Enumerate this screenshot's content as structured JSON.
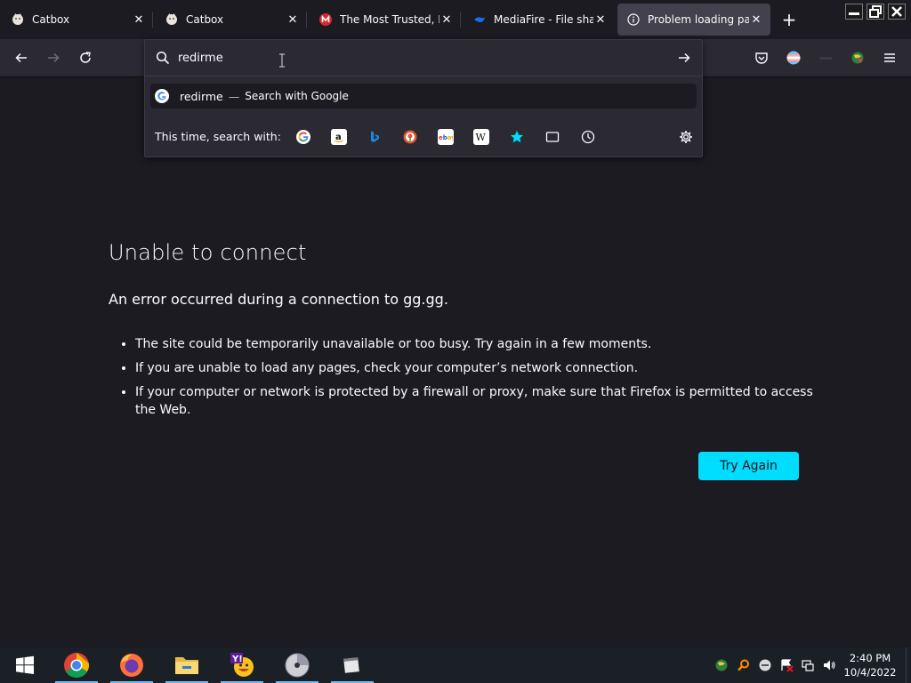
{
  "tabs": [
    {
      "title": "Catbox",
      "favicon": "catbox-icon"
    },
    {
      "title": "Catbox",
      "favicon": "catbox-icon"
    },
    {
      "title": "The Most Trusted, Bes",
      "favicon": "mega-icon"
    },
    {
      "title": "MediaFire - File sharin",
      "favicon": "mediafire-icon"
    },
    {
      "title": "Problem loading page",
      "favicon": "info-icon",
      "selected": true
    }
  ],
  "urlbar": {
    "value": "redirme",
    "suggestion": {
      "query": "redirme",
      "separator": "—",
      "action": "Search with Google"
    },
    "oneoff_label": "This time, search with:",
    "engines": [
      "google-icon",
      "amazon-icon",
      "bing-icon",
      "duckduckgo-icon",
      "ebay-icon",
      "wikipedia-icon",
      "bookmarks-icon",
      "tabs-icon",
      "history-icon"
    ]
  },
  "error": {
    "title": "Unable to connect",
    "description": "An error occurred during a connection to gg.gg.",
    "items": [
      "The site could be temporarily unavailable or too busy. Try again in a few moments.",
      "If you are unable to load any pages, check your computer’s network connection.",
      "If your computer or network is protected by a firewall or proxy, make sure that Firefox is permitted to access the Web."
    ],
    "button": "Try Again"
  },
  "taskbar": {
    "apps": [
      "windows-start-icon",
      "chrome-icon",
      "firefox-icon",
      "file-explorer-icon",
      "yahoo-messenger-icon",
      "dvd-icon",
      "window-icon"
    ],
    "time": "2:40 PM",
    "date": "10/4/2022"
  },
  "colors": {
    "accent": "#00ddff",
    "background": "#1c1b22",
    "toolbar": "#2b2a33"
  }
}
